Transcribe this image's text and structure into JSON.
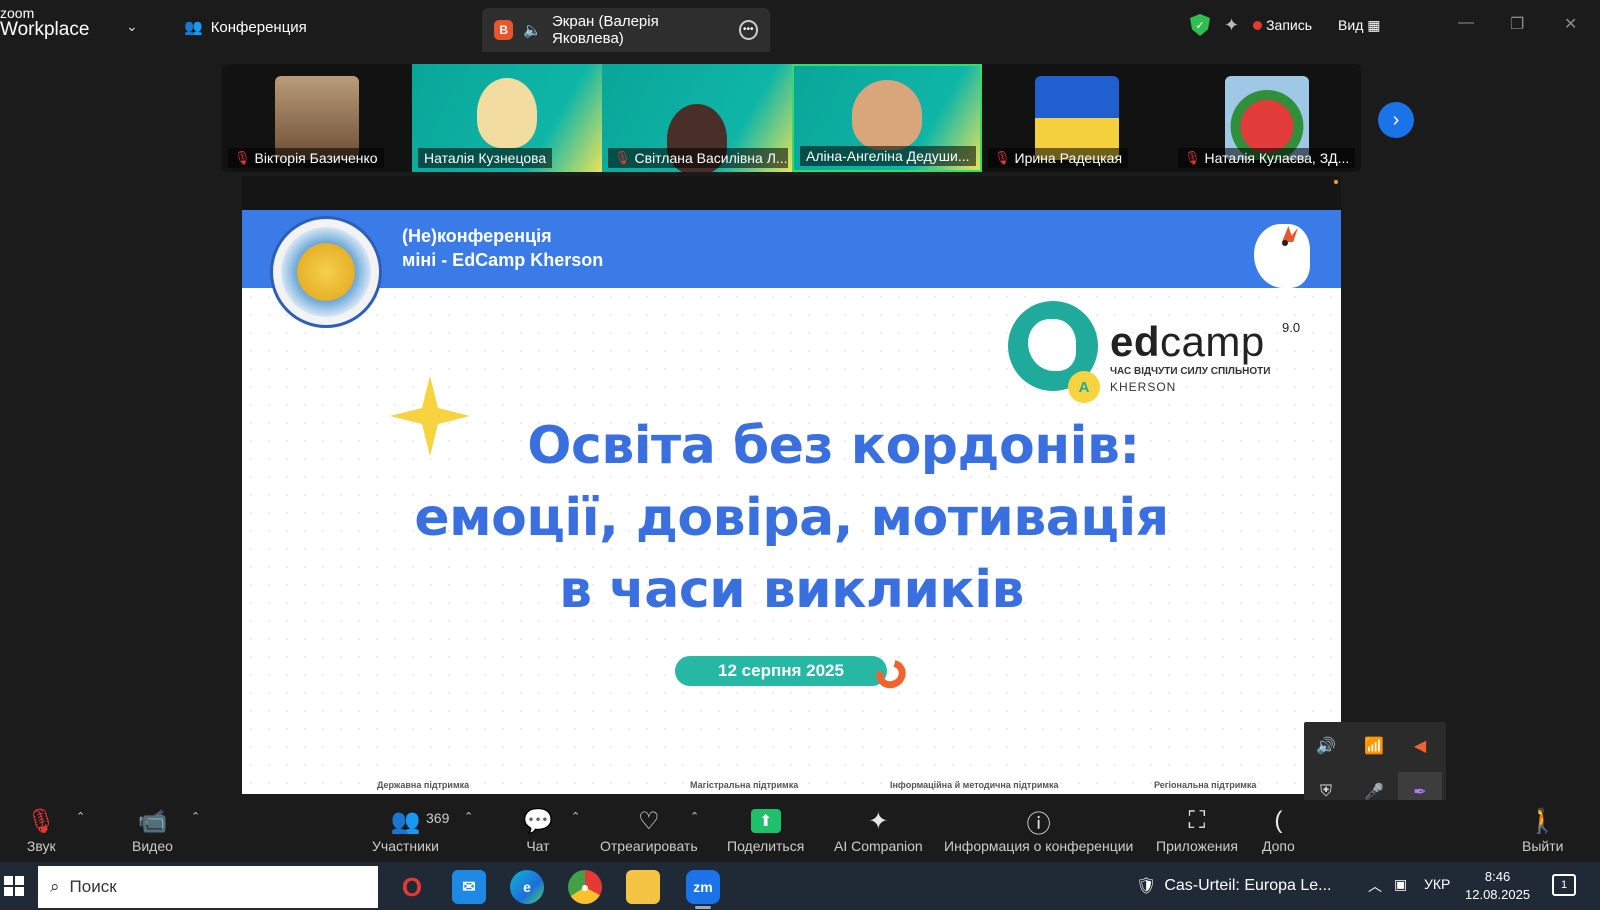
{
  "header": {
    "logo_line1": "zoom",
    "logo_line2": "Workplace",
    "meeting_label": "Конференция",
    "screen_tab_badge": "B",
    "screen_tab_label": "Экран (Валерія Яковлева)",
    "record_label": "Запись",
    "view_label": "Вид"
  },
  "participants": [
    {
      "name": "Вікторія Базиченко",
      "muted": true
    },
    {
      "name": "Наталія Кузнецова",
      "muted": false
    },
    {
      "name": "Світлана Василівна Л...",
      "muted": true
    },
    {
      "name": "Аліна-Ангеліна Дедуши...",
      "muted": false
    },
    {
      "name": "Ирина Радецкая",
      "muted": true
    },
    {
      "name": "Наталія Кулаєва,  ЗД...",
      "muted": true
    }
  ],
  "slide": {
    "header_line1": "(Не)конференція",
    "header_line2": "міні - EdCamp Kherson",
    "edcamp_word_bold": "ed",
    "edcamp_word": "camp",
    "edcamp_version": "9.0",
    "edcamp_badge": "A",
    "edcamp_tagline": "ЧАС ВІДЧУТИ СИЛУ СПІЛЬНОТИ",
    "edcamp_city": "KHERSON",
    "title_line1": "Освіта без кордонів:",
    "title_line2": "емоції, довіра, мотивація",
    "title_line3": "в часи викликів",
    "date": "12 серпня 2025",
    "footer": [
      "Державна підтримка",
      "Магістральна підтримка",
      "Інформаційна й методична підтримка",
      "Регіональна підтримка"
    ]
  },
  "toolbar": {
    "audio_label": "Звук",
    "video_label": "Видео",
    "participants_label": "Участники",
    "participants_count": "369",
    "chat_label": "Чат",
    "react_label": "Отреагировать",
    "share_label": "Поделиться",
    "ai_label": "AI Companion",
    "info_label": "Информация о конференции",
    "apps_label": "Приложения",
    "more_label": "Допо",
    "leave_label": "Выйти"
  },
  "taskbar": {
    "search_placeholder": "Поиск",
    "zoom_app_label": "zm",
    "news_text": "Cas-Urteil: Europa Le...",
    "language": "УКР",
    "time": "8:46",
    "date": "12.08.2025",
    "notifications": "1"
  },
  "colors": {
    "accent_blue": "#1a73e8",
    "slide_blue": "#3a6fe0",
    "teal": "#27b8a5",
    "share_green": "#1fbf6b",
    "record_red": "#e53935"
  }
}
